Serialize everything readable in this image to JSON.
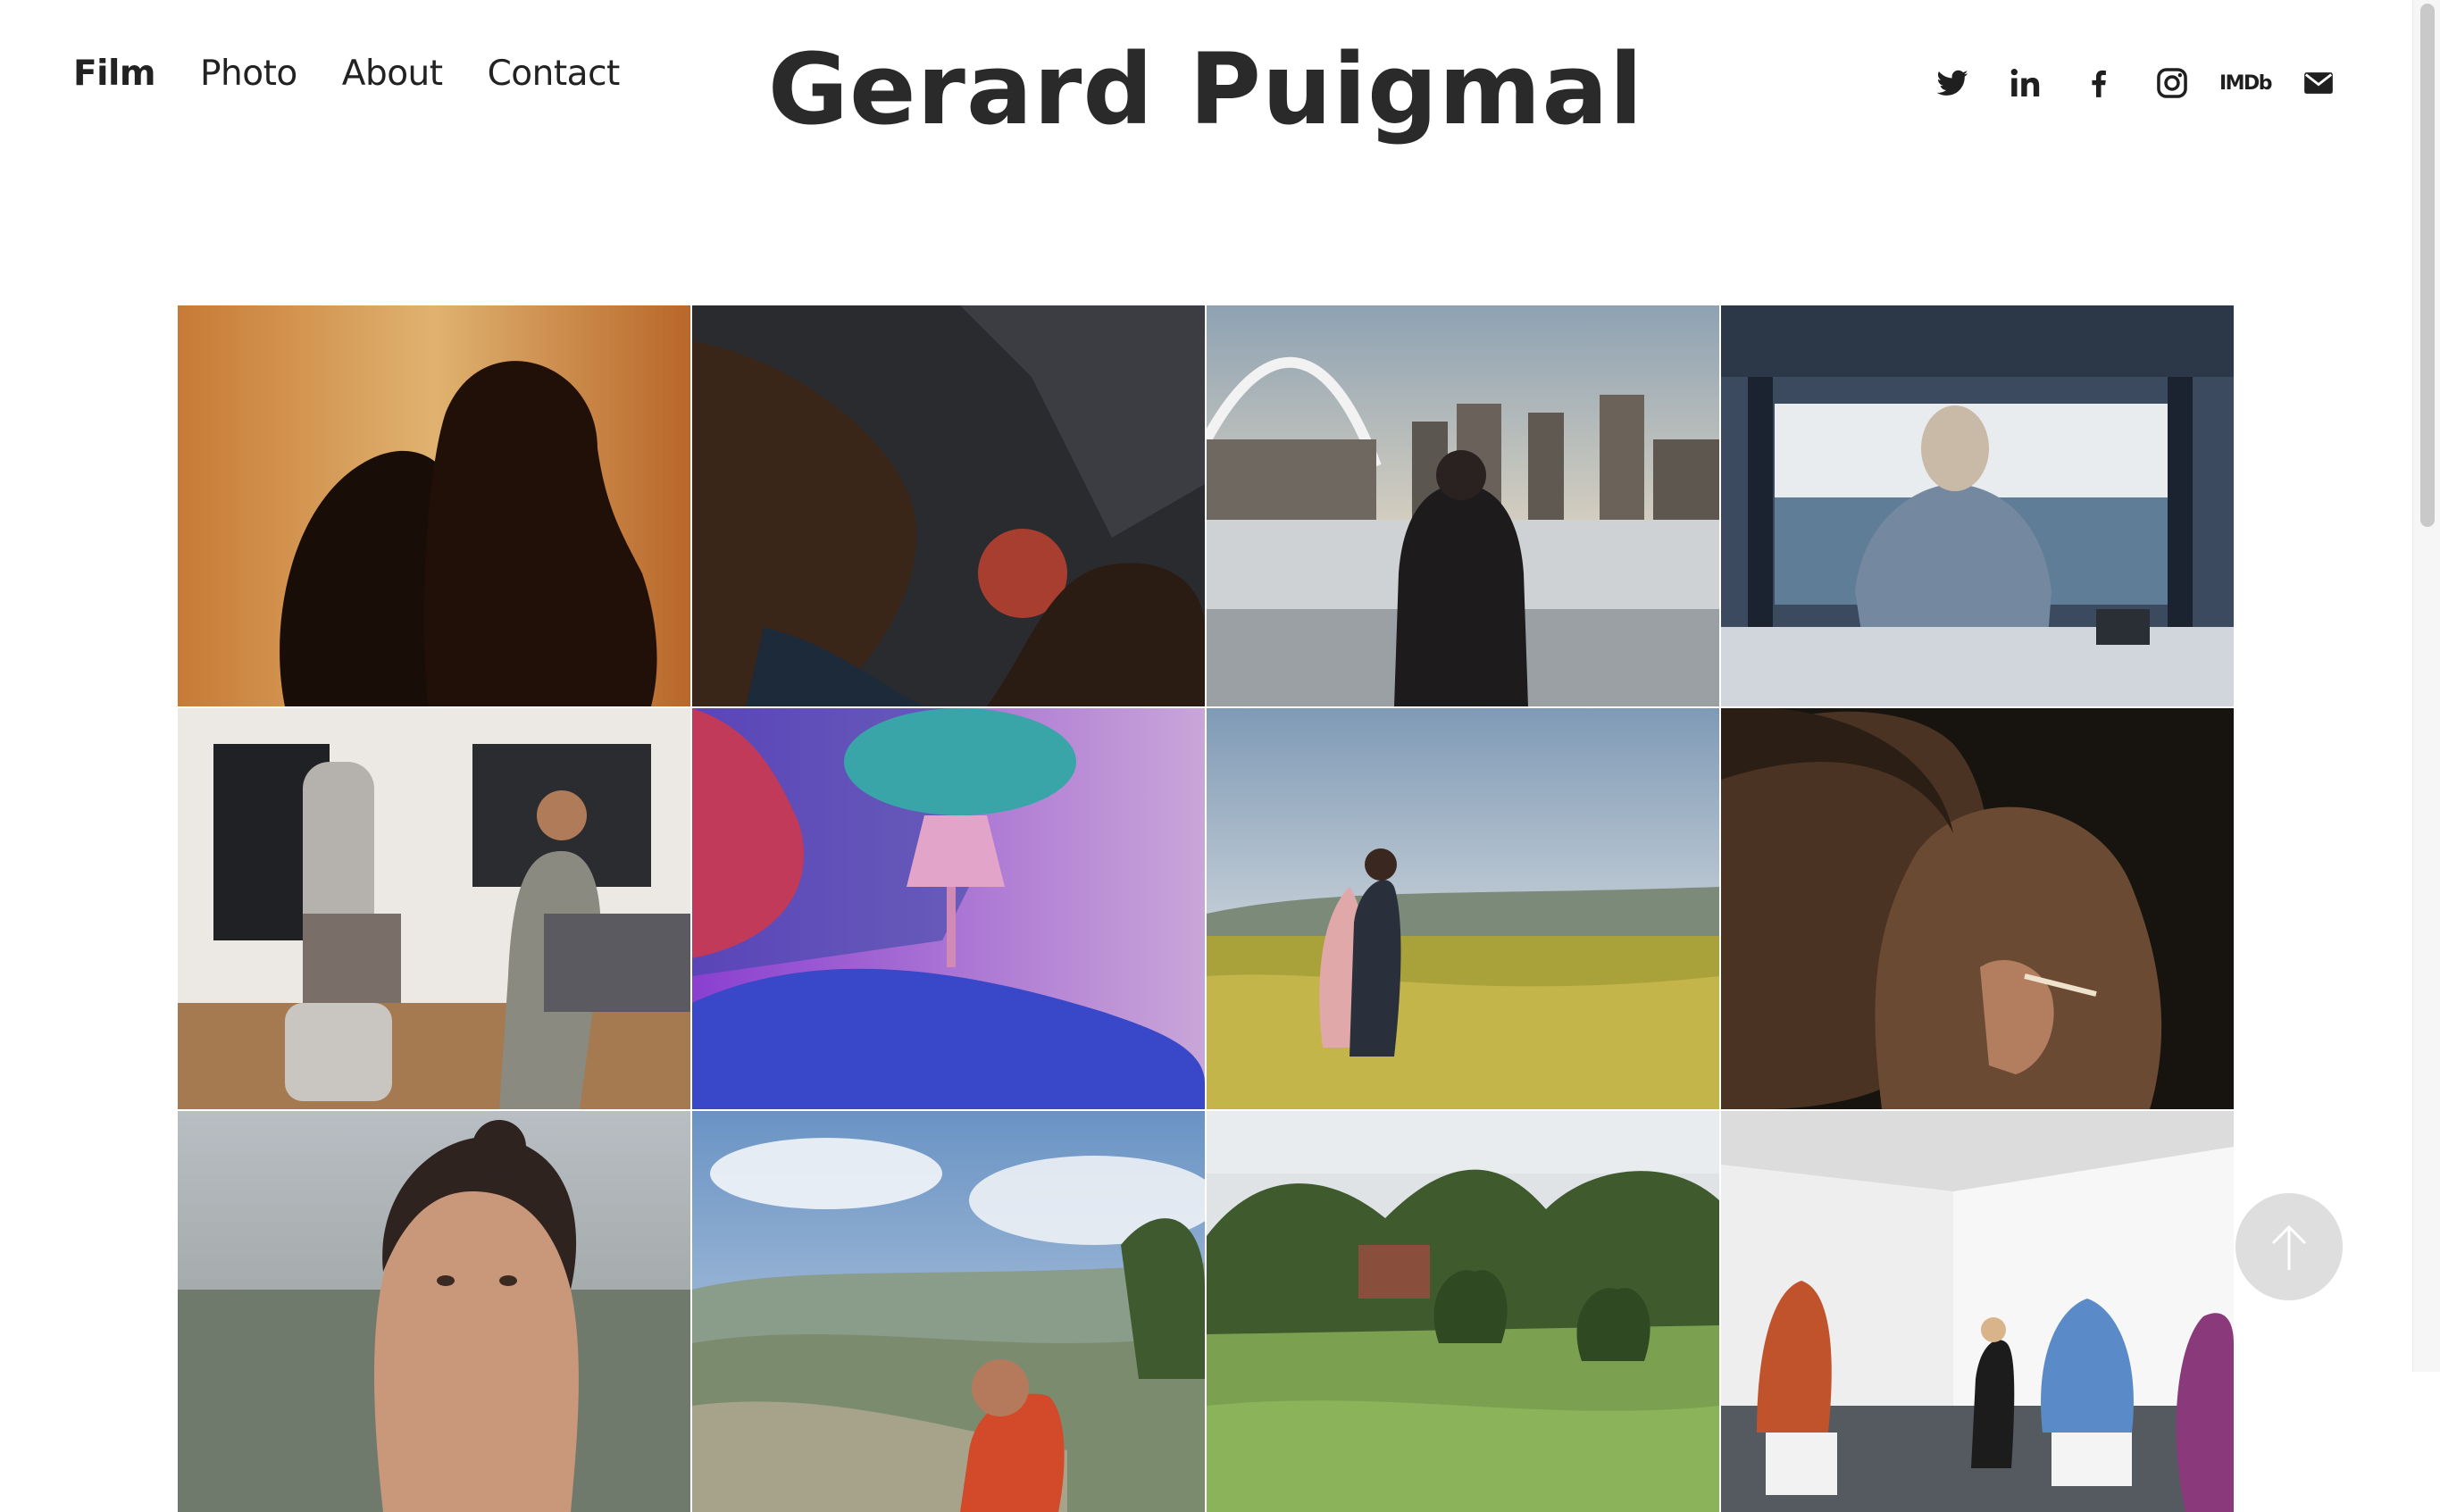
{
  "nav": {
    "items": [
      {
        "label": "Film",
        "active": true
      },
      {
        "label": "Photo",
        "active": false
      },
      {
        "label": "About",
        "active": false
      },
      {
        "label": "Contact",
        "active": false
      }
    ]
  },
  "site_title": "Gerard Puigmal",
  "social": {
    "icons": [
      "twitter-icon",
      "linkedin-icon",
      "facebook-icon",
      "instagram-icon",
      "imdb-icon",
      "email-icon"
    ],
    "imdb_label": "IMDb"
  },
  "colors": {
    "text": "#222222",
    "background": "#ffffff",
    "scroll_button": "#d7d7d7"
  },
  "gallery": {
    "columns": 4,
    "visible_rows": 3,
    "tile_count": 12
  }
}
